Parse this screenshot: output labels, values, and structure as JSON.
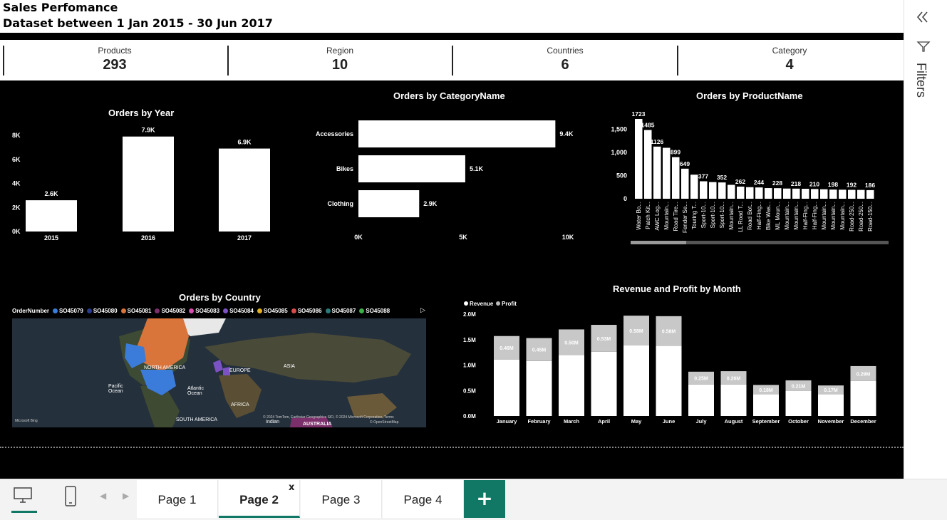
{
  "header": {
    "title": "Sales Perfomance",
    "subtitle": "Dataset between 1 Jan 2015 - 30 Jun 2017"
  },
  "kpis": [
    {
      "label": "Products",
      "value": "293"
    },
    {
      "label": "Region",
      "value": "10"
    },
    {
      "label": "Countries",
      "value": "6"
    },
    {
      "label": "Category",
      "value": "4"
    }
  ],
  "orders_by_year": {
    "title": "Orders by Year",
    "y_ticks": [
      "0K",
      "2K",
      "4K",
      "6K",
      "8K"
    ],
    "categories": [
      "2015",
      "2016",
      "2017"
    ],
    "values": [
      2.6,
      7.9,
      6.9
    ],
    "labels": [
      "2.6K",
      "7.9K",
      "6.9K"
    ]
  },
  "orders_by_category": {
    "title": "Orders by CategoryName",
    "categories": [
      "Accessories",
      "Bikes",
      "Clothing"
    ],
    "values": [
      9.4,
      5.1,
      2.9
    ],
    "labels": [
      "9.4K",
      "5.1K",
      "2.9K"
    ],
    "x_ticks": [
      "0K",
      "5K",
      "10K"
    ]
  },
  "orders_by_product": {
    "title": "Orders by ProductName",
    "y_ticks": [
      "0",
      "500",
      "1,000",
      "1,500"
    ],
    "categories": [
      "Water Bo...",
      "Patch Kit...",
      "AWC Log...",
      "Mountain...",
      "Road Tire...",
      "Fender Se...",
      "Touring T...",
      "Sport-10...",
      "Sport-10...",
      "Sport-10...",
      "Mountain...",
      "LL Road T...",
      "Road Bot...",
      "Half-Fing...",
      "Bike Was...",
      "ML Moun...",
      "Mountain...",
      "Mountain...",
      "Half-Fing...",
      "Half-Fing...",
      "Mountain...",
      "Mountain...",
      "Mountain...",
      "Road-250...",
      "Road-250...",
      "Road-150..."
    ],
    "values": [
      1723,
      1485,
      1126,
      1100,
      899,
      649,
      520,
      377,
      360,
      352,
      300,
      262,
      250,
      244,
      230,
      228,
      220,
      218,
      215,
      210,
      205,
      198,
      195,
      192,
      190,
      186
    ],
    "labels": [
      "1723",
      "1485",
      "1126",
      "",
      "899",
      "649",
      "",
      "377",
      "",
      "352",
      "",
      "262",
      "",
      "244",
      "",
      "228",
      "",
      "218",
      "",
      "210",
      "",
      "198",
      "",
      "192",
      "",
      "186"
    ]
  },
  "orders_by_country": {
    "title": "Orders by Country",
    "legend_title": "OrderNumber",
    "legend": [
      {
        "name": "SO45079",
        "color": "#3b7bd9"
      },
      {
        "name": "SO45080",
        "color": "#2a3a8c"
      },
      {
        "name": "SO45081",
        "color": "#d9743b"
      },
      {
        "name": "SO45082",
        "color": "#7b2f6b"
      },
      {
        "name": "SO45083",
        "color": "#d94fb0"
      },
      {
        "name": "SO45084",
        "color": "#7b52c4"
      },
      {
        "name": "SO45085",
        "color": "#e0b020"
      },
      {
        "name": "SO45086",
        "color": "#d94a4a"
      },
      {
        "name": "SO45087",
        "color": "#2a7b7b"
      },
      {
        "name": "SO45088",
        "color": "#3bb04a"
      }
    ],
    "map_labels": [
      "NORTH AMERICA",
      "EUROPE",
      "ASIA",
      "Pacific Ocean",
      "Atlantic Ocean",
      "AFRICA",
      "SOUTH AMERICA",
      "Indian",
      "AUSTRALIA"
    ],
    "copyright": "© 2024 TomTom, Earthstar Geographics SIO, © 2024 Microsoft Corporation, Terms",
    "osm": "© OpenStreetMap",
    "brand": "Microsoft Bing"
  },
  "revenue_profit": {
    "title": "Revenue and Profit by Month",
    "legend": [
      "Revenue",
      "Profit"
    ],
    "y_ticks": [
      "0.0M",
      "0.5M",
      "1.0M",
      "1.5M",
      "2.0M"
    ],
    "categories": [
      "January",
      "February",
      "March",
      "April",
      "May",
      "June",
      "July",
      "August",
      "September",
      "October",
      "November",
      "December"
    ],
    "revenue": [
      1.11,
      1.08,
      1.2,
      1.26,
      1.39,
      1.38,
      0.62,
      0.62,
      0.43,
      0.49,
      0.43,
      0.69
    ],
    "profit": [
      0.46,
      0.45,
      0.5,
      0.53,
      0.58,
      0.58,
      0.25,
      0.26,
      0.18,
      0.21,
      0.17,
      0.29
    ],
    "profit_labels": [
      "0.46M",
      "0.45M",
      "0.50M",
      "0.53M",
      "0.58M",
      "0.58M",
      "0.25M",
      "0.26M",
      "0.18M",
      "0.21M",
      "0.17M",
      "0.29M"
    ]
  },
  "sidepane": {
    "filters_label": "Filters"
  },
  "bottom": {
    "tabs": [
      "Page 1",
      "Page 2",
      "Page 3",
      "Page 4"
    ],
    "add": "+",
    "close": "x"
  }
}
